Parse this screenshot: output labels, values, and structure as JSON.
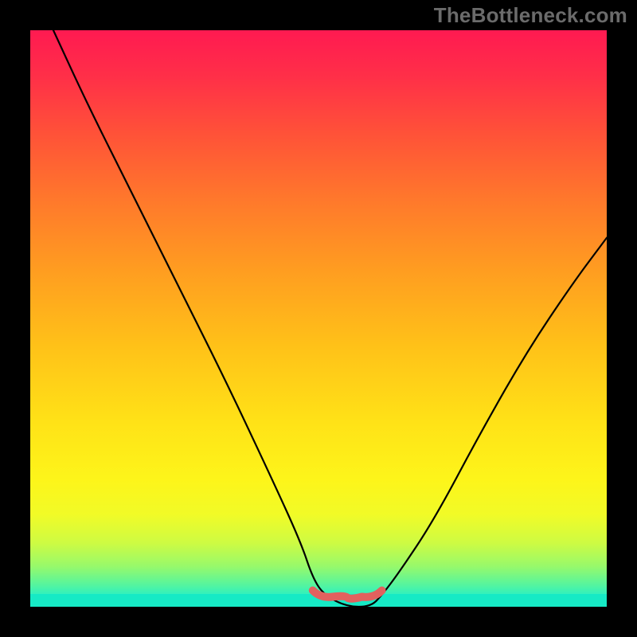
{
  "watermark": "TheBottleneck.com",
  "chart_data": {
    "type": "line",
    "title": "",
    "xlabel": "",
    "ylabel": "",
    "xlim": [
      0,
      100
    ],
    "ylim": [
      0,
      100
    ],
    "series": [
      {
        "name": "bottleneck-curve",
        "x": [
          4,
          10,
          18,
          26,
          34,
          42,
          47,
          49,
          51,
          55,
          59,
          61,
          64,
          70,
          78,
          86,
          94,
          100
        ],
        "values": [
          100,
          87,
          71,
          55,
          39,
          22,
          11,
          5,
          2,
          0,
          0,
          2,
          6,
          15,
          30,
          44,
          56,
          64
        ]
      }
    ],
    "band": {
      "name": "optimal-range",
      "x_start": 49,
      "x_end": 61,
      "y": 2
    }
  }
}
